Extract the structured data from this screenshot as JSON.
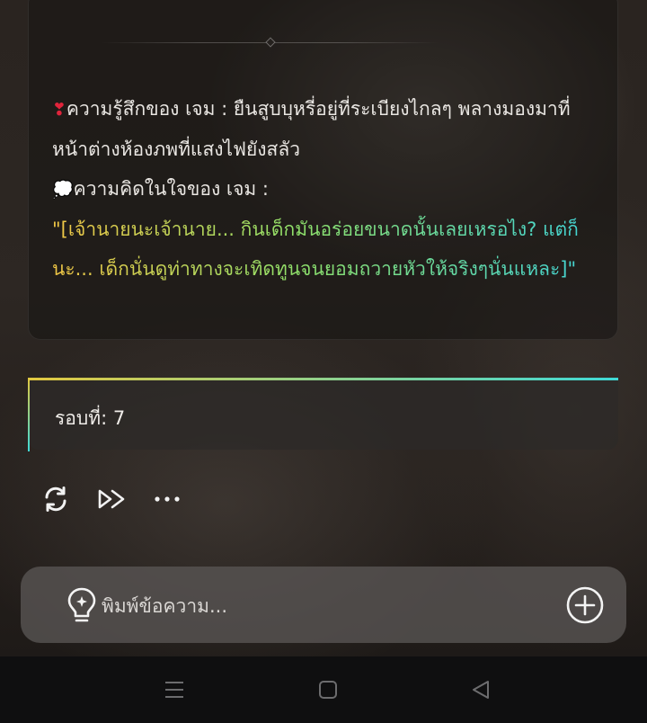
{
  "story": {
    "feeling_emoji": "❣",
    "feeling_label": "ความรู้สึกของ เจม : ยืนสูบบุหรี่อยู่ที่ระเบียงไกลๆ พลางมองมาที่หน้าต่างห้องภพที่แสงไฟยังสลัว",
    "thought_emoji": "💭",
    "thought_label": "ความคิดในใจของ เจม :",
    "thought_text": "\"[เจ้านายนะเจ้านาย... กินเด็กมันอร่อยขนาดนั้นเลยเหรอไง? แต่ก็นะ... เด็กนั่นดูท่าทางจะเทิดทูนจนยอมถวายหัวให้จริงๆนั่นแหละ]\""
  },
  "round": {
    "label": "รอบที่: 7"
  },
  "actions": {
    "icons": [
      "refresh-icon",
      "fast-forward-icon",
      "more-dots-icon"
    ]
  },
  "composer": {
    "placeholder": "พิมพ์ข้อความ...",
    "left_icon": "lightbulb-icon",
    "right_icon": "plus-circle-icon"
  },
  "navbar": {
    "icons": [
      "menu-icon",
      "home-square-icon",
      "back-triangle-icon"
    ]
  },
  "colors": {
    "thought_gradient_start": "#f2c745",
    "thought_gradient_mid": "#8ee06a",
    "thought_gradient_end": "#3fd3d9",
    "heart": "#e0243b"
  }
}
